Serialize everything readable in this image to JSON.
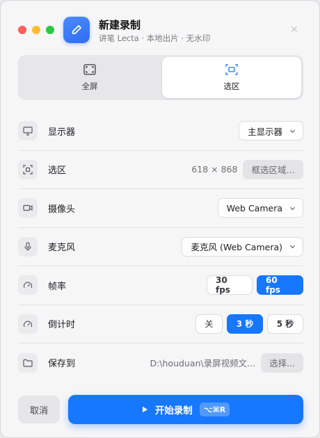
{
  "window": {
    "title": "新建录制",
    "subtitle": "讲笔 Lecta · 本地出片 · 无水印",
    "close_glyph": "✕"
  },
  "mode": {
    "fullscreen_label": "全屏",
    "region_label": "选区",
    "active": "region"
  },
  "settings": {
    "display": {
      "label": "显示器",
      "value": "主显示器"
    },
    "region": {
      "label": "选区",
      "size": "618 × 868",
      "button": "框选区域…"
    },
    "camera": {
      "label": "摄像头",
      "value": "Web Camera"
    },
    "mic": {
      "label": "麦克风",
      "value": "麦克风 (Web Camera)"
    },
    "framerate": {
      "label": "帧率",
      "options": [
        "30 fps",
        "60 fps"
      ],
      "selected": "60 fps"
    },
    "countdown": {
      "label": "倒计时",
      "options": [
        "关",
        "3 秒",
        "5 秒"
      ],
      "selected": "3 秒"
    },
    "save": {
      "label": "保存到",
      "path": "D:\\houduan\\录屏视频文...",
      "button": "选择..."
    }
  },
  "footer": {
    "cancel_label": "取消",
    "start_label": "开始录制",
    "shortcut": "⌥⌘R"
  },
  "colors": {
    "accent": "#1677ff",
    "app_icon": "#3b7bfb"
  }
}
